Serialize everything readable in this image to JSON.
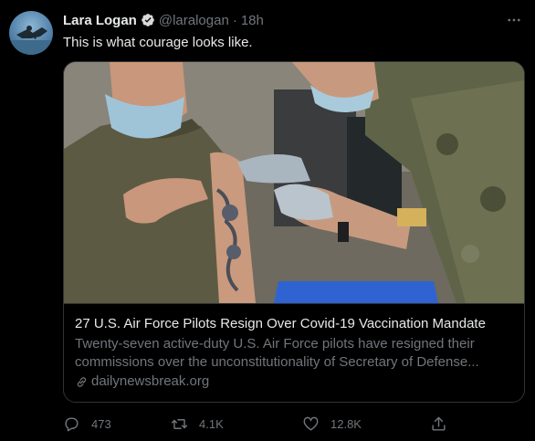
{
  "tweet": {
    "author_name": "Lara Logan",
    "handle": "@laralogan",
    "separator": "·",
    "time": "18h",
    "text": "This is what courage looks like."
  },
  "card": {
    "title": "27 U.S. Air Force Pilots Resign Over Covid-19 Vaccination Mandate",
    "description": "Twenty-seven active-duty U.S. Air Force pilots have resigned their commissions over the unconstitutionality of Secretary of Defense...",
    "domain": "dailynewsbreak.org"
  },
  "actions": {
    "reply_count": "473",
    "retweet_count": "4.1K",
    "like_count": "12.8K"
  },
  "icons": {
    "verified": "verified-badge-icon",
    "more": "more-icon",
    "link": "link-icon",
    "reply": "reply-icon",
    "retweet": "retweet-icon",
    "like": "like-icon",
    "share": "share-icon"
  },
  "colors": {
    "background": "#000000",
    "text_primary": "#e7e9ea",
    "text_secondary": "#71767b",
    "border": "#2f3336"
  }
}
